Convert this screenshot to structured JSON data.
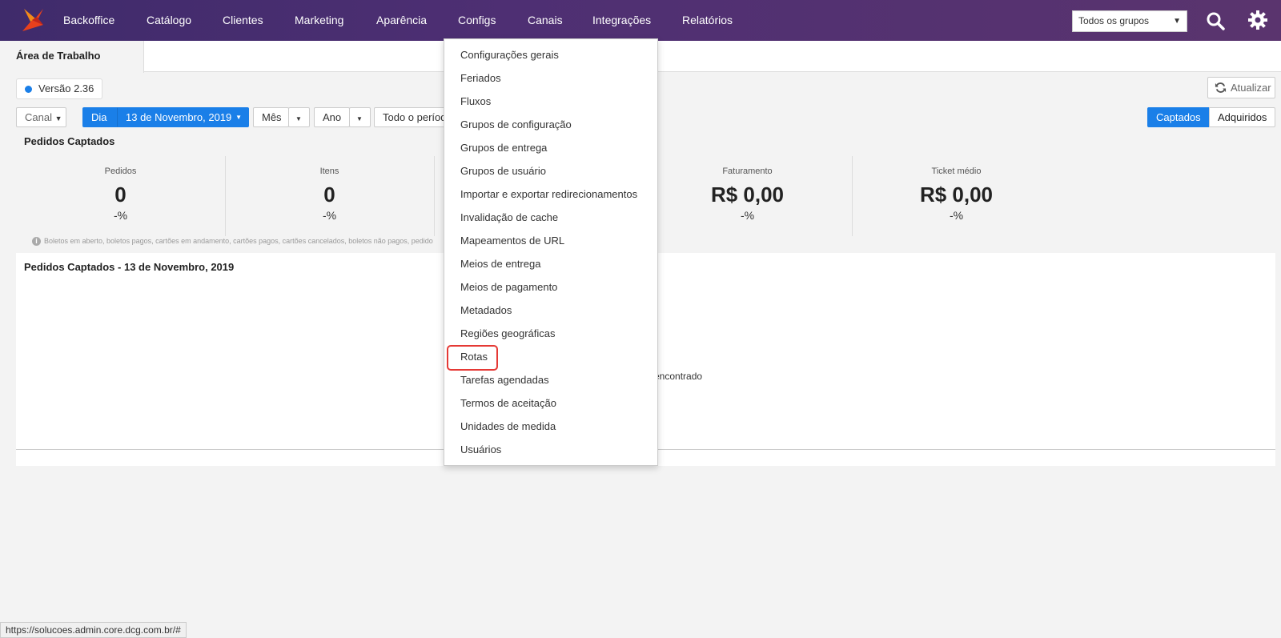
{
  "nav": {
    "items": [
      "Backoffice",
      "Catálogo",
      "Clientes",
      "Marketing",
      "Aparência",
      "Configs",
      "Canais",
      "Integrações",
      "Relatórios"
    ],
    "group_select": "Todos os grupos"
  },
  "tab": {
    "active": "Área de Trabalho"
  },
  "version": "Versão 2.36",
  "refresh_label": "Atualizar",
  "filters": {
    "canal": "Canal",
    "dia": "Dia",
    "date": "13 de Novembro, 2019",
    "mes": "Mês",
    "ano": "Ano",
    "periodo": "Todo o períod",
    "captados": "Captados",
    "adquiridos": "Adquiridos"
  },
  "section_title": "Pedidos Captados",
  "stats": [
    {
      "label": "Pedidos",
      "value": "0",
      "pct": "-%"
    },
    {
      "label": "Itens",
      "value": "0",
      "pct": "-%"
    },
    {
      "label": "Faturamento",
      "value": "R$ 0,00",
      "pct": "-%"
    },
    {
      "label": "Ticket médio",
      "value": "R$ 0,00",
      "pct": "-%"
    }
  ],
  "note": "Boletos em aberto, boletos pagos, cartões em andamento, cartões pagos, cartões cancelados, boletos não pagos, pedido",
  "panel": {
    "title": "Pedidos Captados - 13 de Novembro, 2019",
    "empty_text": "encontrado"
  },
  "dropdown": {
    "items": [
      "Configurações gerais",
      "Feriados",
      "Fluxos",
      "Grupos de configuração",
      "Grupos de entrega",
      "Grupos de usuário",
      "Importar e exportar redirecionamentos",
      "Invalidação de cache",
      "Mapeamentos de URL",
      "Meios de entrega",
      "Meios de pagamento",
      "Metadados",
      "Regiões geográficas",
      "Rotas",
      "Tarefas agendadas",
      "Termos de aceitação",
      "Unidades de medida",
      "Usuários"
    ],
    "highlighted": "Rotas"
  },
  "status_url": "https://solucoes.admin.core.dcg.com.br/#",
  "colors": {
    "nav_bg": "#4e2f73",
    "accent": "#1a7fe8",
    "highlight": "#e53935"
  }
}
